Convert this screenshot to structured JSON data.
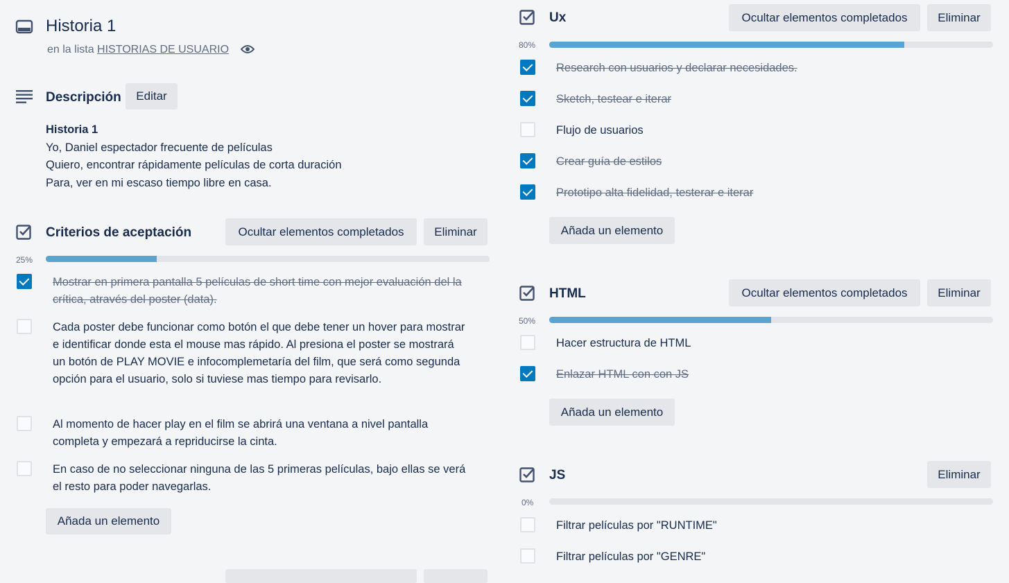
{
  "card": {
    "title": "Historia 1",
    "list_prefix": "en la lista",
    "list_name": "HISTORIAS DE USUARIO"
  },
  "description": {
    "heading": "Descripción",
    "edit_label": "Editar",
    "lines": [
      "Historia 1",
      "Yo, Daniel espectador frecuente de películas",
      "Quiero, encontrar rápidamente películas de corta duración",
      "Para, ver en mi escaso tiempo libre en casa."
    ]
  },
  "labels": {
    "hide_completed": "Ocultar elementos completados",
    "delete": "Eliminar",
    "add_item": "Añada un elemento"
  },
  "checklists": [
    {
      "title": "Criterios de aceptación",
      "percent_label": "25%",
      "percent": 25,
      "items": [
        {
          "text": "Mostrar en primera pantalla 5 películas de short time con mejor evaluación del la crítica, através del poster (data).",
          "checked": true
        },
        {
          "text": "Cada poster debe funcionar como botón el que debe tener un hover para mostrar e identificar donde esta el mouse mas rápido. Al presiona el poster se mostrará un botón de PLAY MOVIE e infocomplemetaría del film, que será como segunda opción para el usuario, solo si tuviese mas tiempo para revisarlo.",
          "checked": false
        },
        {
          "text": "Al momento de hacer play en el film se abrirá una ventana a nivel pantalla completa y empezará a repriducirse la cinta.",
          "checked": false
        },
        {
          "text": "En caso de no seleccionar ninguna de las 5 primeras películas, bajo ellas se verá el resto para poder navegarlas.",
          "checked": false
        }
      ]
    },
    {
      "title": "Ux",
      "percent_label": "80%",
      "percent": 80,
      "items": [
        {
          "text": "Research con usuarios y declarar necesidades.",
          "checked": true
        },
        {
          "text": "Sketch, testear e iterar",
          "checked": true
        },
        {
          "text": "Flujo de usuarios",
          "checked": false
        },
        {
          "text": "Crear guía de estilos",
          "checked": true
        },
        {
          "text": "Prototipo alta fidelidad, testerar e iterar",
          "checked": true
        }
      ]
    },
    {
      "title": "HTML",
      "percent_label": "50%",
      "percent": 50,
      "items": [
        {
          "text": "Hacer estructura de HTML",
          "checked": false
        },
        {
          "text": "Enlazar HTML con con JS",
          "checked": true
        }
      ]
    },
    {
      "title": "JS",
      "percent_label": "0%",
      "percent": 0,
      "items": [
        {
          "text": "Filtrar películas por \"RUNTIME\"",
          "checked": false
        },
        {
          "text": "Filtrar películas por \"GENRE\"",
          "checked": false
        }
      ]
    }
  ],
  "colors": {
    "accent": "#0079bf",
    "progress": "#5ba4cf",
    "button_bg": "#e4e6ea"
  }
}
